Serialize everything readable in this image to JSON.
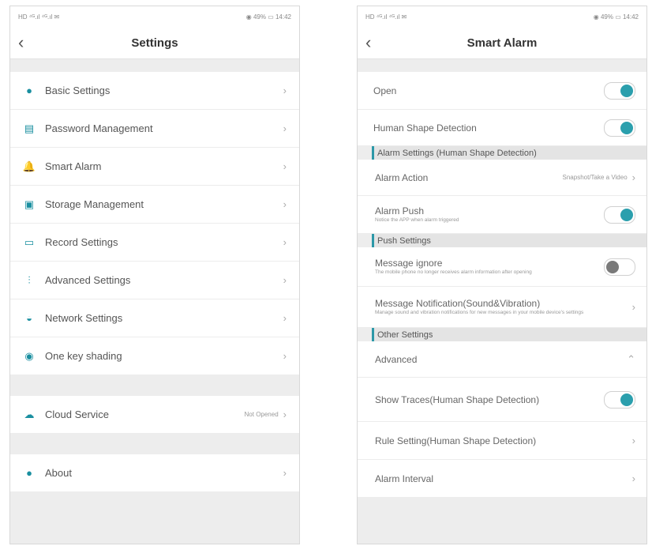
{
  "left": {
    "status": {
      "left": "HD ⁴ᴳ.ıl ⁴ᴳ.ıl ✉",
      "right": "◉ 49% ▭ 14:42"
    },
    "title": "Settings",
    "items": [
      {
        "icon": "●",
        "label": "Basic Settings"
      },
      {
        "icon": "▤",
        "label": "Password Management"
      },
      {
        "icon": "🔔",
        "label": "Smart Alarm"
      },
      {
        "icon": "▣",
        "label": "Storage Management"
      },
      {
        "icon": "▭",
        "label": "Record Settings"
      },
      {
        "icon": "⫶",
        "label": "Advanced Settings"
      },
      {
        "icon": "◒",
        "label": "Network Settings"
      },
      {
        "icon": "◉",
        "label": "One key shading"
      }
    ],
    "cloud": {
      "icon": "☁",
      "label": "Cloud Service",
      "value": "Not Opened"
    },
    "about": {
      "icon": "●",
      "label": "About"
    },
    "chevron": "›",
    "back": "‹"
  },
  "right": {
    "status": {
      "left": "HD ⁴ᴳ.ıl ⁴ᴳ.ıl ✉",
      "right": "◉ 49% ▭ 14:42"
    },
    "title": "Smart Alarm",
    "open_label": "Open",
    "human_shape_label": "Human Shape Detection",
    "section_alarm": "Alarm Settings (Human Shape Detection)",
    "alarm_action_label": "Alarm Action",
    "alarm_action_value": "Snapshot/Take a Video",
    "alarm_push_label": "Alarm Push",
    "alarm_push_sub": "Notice the APP when alarm triggered",
    "section_push": "Push Settings",
    "message_ignore_label": "Message ignore",
    "message_ignore_sub": "The mobile phone no longer receives alarm information after opening",
    "message_notif_label": "Message Notification(Sound&Vibration)",
    "message_notif_sub": "Manage sound and vibration notifications for new messages in your mobile device's settings",
    "section_other": "Other Settings",
    "advanced_label": "Advanced",
    "advanced_chevron": "⌃",
    "show_traces_label": "Show Traces(Human Shape Detection)",
    "rule_setting_label": "Rule Setting(Human Shape Detection)",
    "alarm_interval_label": "Alarm Interval",
    "chevron": "›",
    "back": "‹",
    "toggles": {
      "open": "on",
      "human_shape": "on",
      "alarm_push": "on",
      "message_ignore": "off",
      "show_traces": "on"
    },
    "accent": "#2b9fad"
  }
}
